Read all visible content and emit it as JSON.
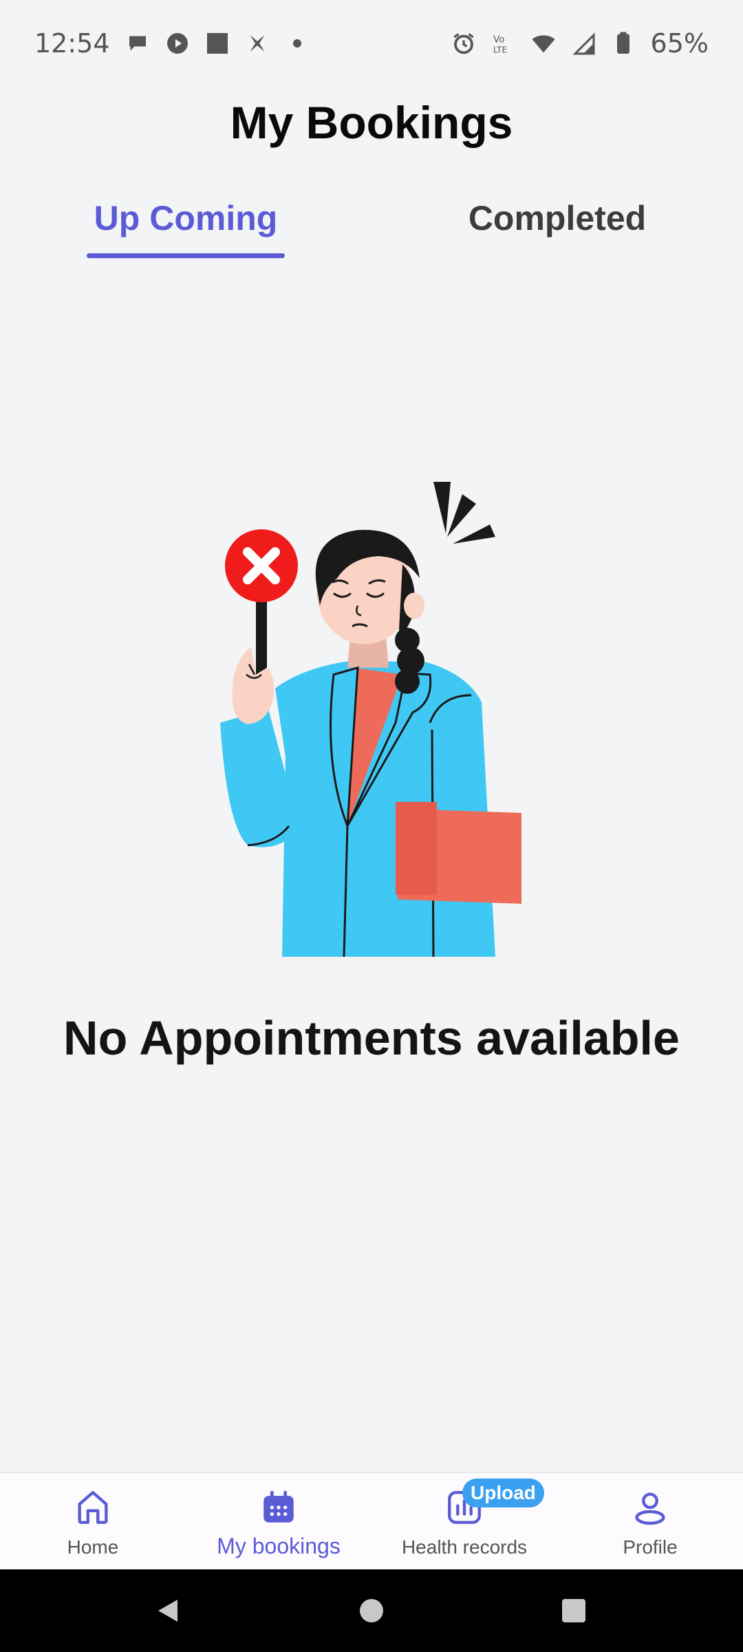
{
  "status_bar": {
    "time": "12:54",
    "battery": "65%",
    "left_icons": [
      "chat-bubble-icon",
      "play-circle-icon",
      "square-app-icon",
      "x-app-icon",
      "dot-icon"
    ],
    "right_icons": [
      "alarm-icon",
      "volte-icon",
      "wifi-icon",
      "signal-5g-icon",
      "battery-icon"
    ]
  },
  "header": {
    "title": "My Bookings"
  },
  "tabs": [
    {
      "label": "Up Coming",
      "active": true
    },
    {
      "label": "Completed",
      "active": false
    }
  ],
  "empty_state": {
    "illustration": "doctor-with-cross-sign-illustration",
    "message": "No Appointments available"
  },
  "bottom_nav": {
    "items": [
      {
        "label": "Home",
        "icon": "home-icon",
        "active": false
      },
      {
        "label": "My bookings",
        "icon": "calendar-icon",
        "active": true
      },
      {
        "label": "Health records",
        "icon": "bar-chart-icon",
        "active": false,
        "badge": "Upload"
      },
      {
        "label": "Profile",
        "icon": "user-icon",
        "active": false
      }
    ]
  },
  "colors": {
    "accent": "#5b5bd6",
    "background": "#f2f4f5",
    "badge": "#3aa0ef",
    "coat": "#40c8f4",
    "cross_sign": "#f01c1c"
  }
}
